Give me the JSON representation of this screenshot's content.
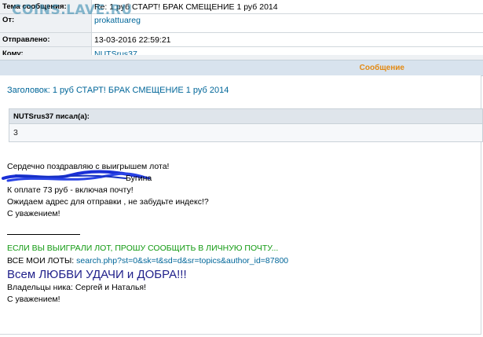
{
  "header": {
    "subject_label": "Тема сообщения:",
    "subject_value": "Re: 1 руб СТАРТ! БРАК СМЕЩЕНИЕ 1 руб 2014",
    "from_label": "От:",
    "from_value": "prokattuareg",
    "sent_label": "Отправлено:",
    "sent_value": "13-03-2016 22:59:21",
    "to_label": "Кому:",
    "to_value": "NUTSrus37"
  },
  "watermark": "COINS.LAVE.RU",
  "message_header": "Сообщение",
  "subject_line": "Заголовок: 1 руб СТАРТ! БРАК СМЕЩЕНИЕ 1 руб 2014",
  "quote": {
    "author": "NUTSrus37 писал(а):",
    "text": "3"
  },
  "body": {
    "line1": "Сердечно поздравляю с выигрышем лота!",
    "line2_tail": "Бугина",
    "line3": "К оплате 73 руб - включая почту!",
    "line4": "Ожидаем адрес для отправки , не забудьте индекс!?",
    "line5": "С уважением!"
  },
  "signature": {
    "won_lot": "ЕСЛИ ВЫ ВЫИГРАЛИ ЛОТ, ПРОШУ СООБЩИТЬ В ЛИЧНУЮ ПОЧТУ...",
    "all_lots_label": "ВСЕ МОИ ЛОТЫ:",
    "all_lots_link": "search.php?st=0&sk=t&sd=d&sr=topics&author_id=87800",
    "love": "Всем ЛЮБВИ УДАЧИ и ДОБРА!!!",
    "owners": "Владельцы ника: Сергей и Наталья!",
    "regards": "С уважением!"
  },
  "colors": {
    "link": "#006699",
    "accent_orange": "#e38a14",
    "green": "#119a11",
    "scribble": "#1a2fd6"
  }
}
